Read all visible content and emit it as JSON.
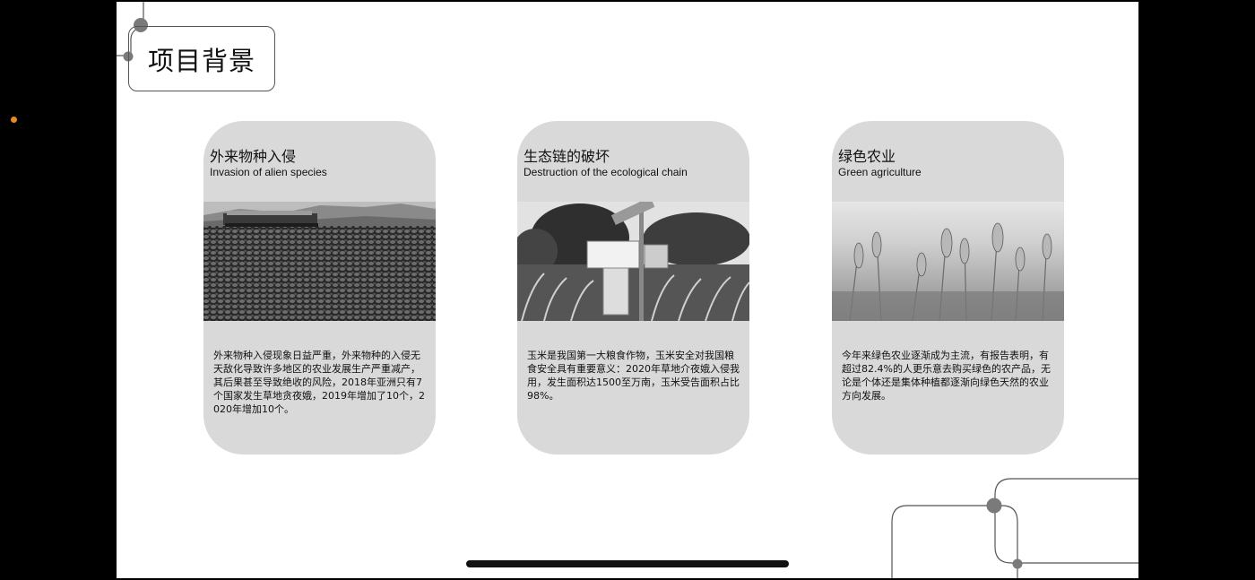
{
  "slide": {
    "title": "项目背景"
  },
  "cards": [
    {
      "title_zh": "外来物种入侵",
      "title_en": "Invasion of alien species",
      "photo_icon": "water-hyacinth-photo",
      "body": "外来物种入侵现象日益严重，外来物种的入侵无天敌化导致许多地区的农业发展生产严重减产，其后果甚至导致绝收的风险，2018年亚洲只有7个国家发生草地贪夜娥，2019年增加了10个，2020年增加10个。"
    },
    {
      "title_zh": "生态链的破坏",
      "title_en": "Destruction of the ecological chain",
      "photo_icon": "corn-field-monitor-photo",
      "body": "玉米是我国第一大粮食作物，玉米安全对我国粮食安全具有重要意义：2020年草地介夜娥入侵我用，发生面积达1500至万南，玉米受告面积占比98%。"
    },
    {
      "title_zh": "绿色农业",
      "title_en": "Green agriculture",
      "photo_icon": "wheat-field-photo",
      "body": "今年来绿色农业逐渐成为主流，有报告表明，有超过82.4%的人更乐意去购买绿色的农产品，无论是个体还是集体种植都逐渐向绿色天然的农业方向发展。"
    }
  ],
  "colors": {
    "background": "#000000",
    "slide": "#ffffff",
    "card": "#d9d9d9",
    "accent_dot": "#e88b1f",
    "deco_line": "#555555",
    "deco_dot": "#7a7a7a"
  }
}
